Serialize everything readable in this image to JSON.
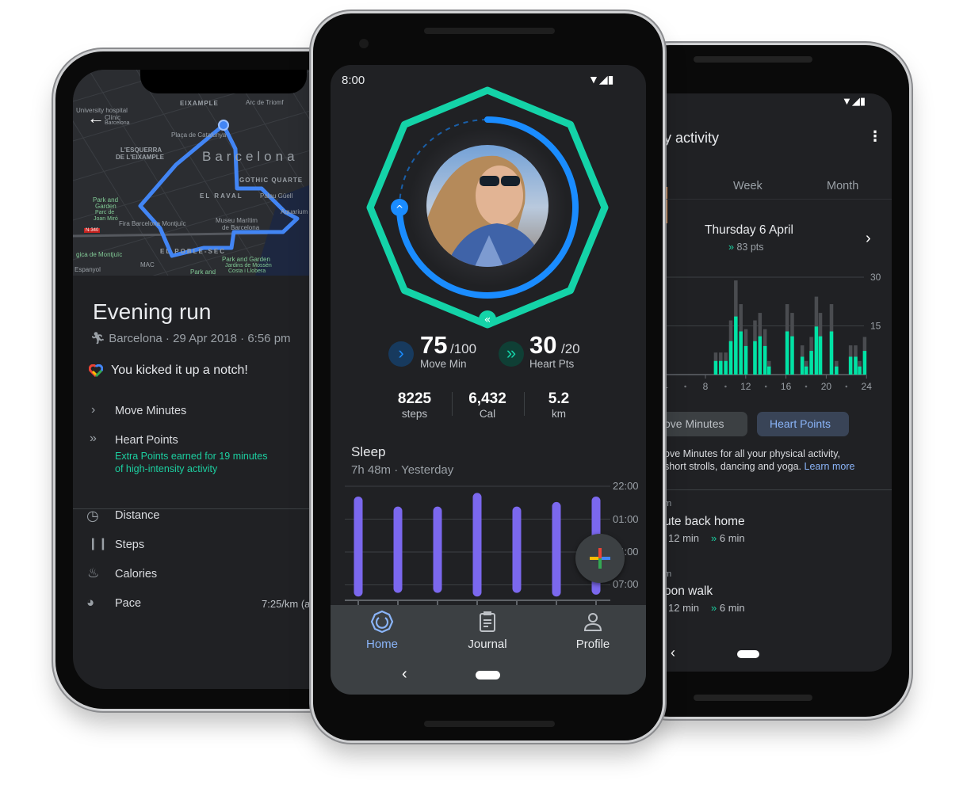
{
  "colors": {
    "teal": "#14d3a8",
    "blue_ring": "#1a8cff",
    "sleep_bar": "#7b68ee",
    "heart_green": "#00e3a5",
    "grey_bar": "#4a4c50",
    "accent_link": "#8ab4f8",
    "background": "#202124"
  },
  "left_phone": {
    "map": {
      "labels": [
        "EIXAMPLE",
        "Arc de Triomf",
        "University hospital",
        "Clínic",
        "Barcelona",
        "Plaça de Catalunya",
        "L'ESQUERRA",
        "DE L'EIXAMPLE",
        "Barcelona",
        "GOTHIC QUARTE",
        "EL RAVAL",
        "Palau Güell",
        "Park and",
        "Garden",
        "Parc de",
        "Joan Miró",
        "Fira Barcelona Montjuïc",
        "Museu Marítim",
        "de Barcelona",
        "Aquarium",
        "N-340",
        "EL POBLE-SEC",
        "Park and Garden",
        "Jardins de Mossèn",
        "Costa i Llobera",
        "MAC",
        "gica de Montjuïc",
        "Espanyol",
        "Park and"
      ],
      "back_icon": "arrow-left-icon"
    },
    "title": "Evening run",
    "subtitle": "Barcelona · 29 Apr 2018 · 6:56 pm",
    "achievement": "You kicked it up a notch!",
    "move_minutes": "Move Minutes",
    "heart_points": "Heart Points",
    "heart_note_1": "Extra Points earned for 19 minutes",
    "heart_note_2": "of high-intensity activity",
    "metrics": [
      {
        "label": "Distance",
        "icon": "distance-icon"
      },
      {
        "label": "Steps",
        "icon": "steps-icon"
      },
      {
        "label": "Calories",
        "icon": "flame-icon"
      },
      {
        "label": "Pace",
        "icon": "speedometer-icon",
        "value": "7:25/km (a"
      }
    ]
  },
  "center_phone": {
    "status_time": "8:00",
    "move_min": {
      "value": "75",
      "goal": "/100",
      "label": "Move Min",
      "progress": 0.75
    },
    "heart_pts": {
      "value": "30",
      "goal": "/20",
      "label": "Heart Pts",
      "progress": 1.0
    },
    "stats": [
      {
        "value": "8225",
        "label": "steps"
      },
      {
        "value": "6,432",
        "label": "Cal"
      },
      {
        "value": "5.2",
        "label": "km"
      }
    ],
    "sleep": {
      "title": "Sleep",
      "subtitle": "7h 48m · Yesterday",
      "axis_labels": [
        "22:00",
        "01:00",
        "04:00",
        "07:00"
      ],
      "bars": [
        {
          "start": "23:20",
          "end": "07:40"
        },
        {
          "start": "00:15",
          "end": "07:20"
        },
        {
          "start": "00:15",
          "end": "07:20"
        },
        {
          "start": "23:00",
          "end": "07:40"
        },
        {
          "start": "00:15",
          "end": "07:20"
        },
        {
          "start": "23:50",
          "end": "07:40"
        },
        {
          "start": "23:20",
          "end": "07:30"
        }
      ]
    },
    "nav": [
      {
        "label": "Home",
        "icon": "home-ring-icon",
        "active": true
      },
      {
        "label": "Journal",
        "icon": "clipboard-icon"
      },
      {
        "label": "Profile",
        "icon": "person-icon"
      }
    ]
  },
  "right_phone": {
    "title": "y activity",
    "tabs": [
      "Week",
      "Month"
    ],
    "date": "Thursday 6 April",
    "points": "83 pts",
    "chart": {
      "y_ticks": [
        "30",
        "15"
      ],
      "x_ticks": [
        "4",
        "8",
        "12",
        "16",
        "20",
        "24"
      ],
      "ylim": [
        0,
        30
      ],
      "bars": [
        {
          "h": 9,
          "total": 6.8,
          "heart": 4.2
        },
        {
          "h": 9.5,
          "total": 6.8,
          "heart": 4.2
        },
        {
          "h": 10,
          "total": 6.8,
          "heart": 4.2
        },
        {
          "h": 10.5,
          "total": 16.7,
          "heart": 10.3
        },
        {
          "h": 11,
          "total": 29,
          "heart": 17.9
        },
        {
          "h": 11.5,
          "total": 21.7,
          "heart": 13.3
        },
        {
          "h": 12,
          "total": 14,
          "heart": 8.8
        },
        {
          "h": 12.9,
          "total": 16.7,
          "heart": 10.3
        },
        {
          "h": 13.4,
          "total": 19,
          "heart": 11.8
        },
        {
          "h": 13.9,
          "total": 14,
          "heart": 8.8
        },
        {
          "h": 14.3,
          "total": 4.2,
          "heart": 2.5
        },
        {
          "h": 16.1,
          "total": 21.7,
          "heart": 13.3
        },
        {
          "h": 16.6,
          "total": 19,
          "heart": 11.8
        },
        {
          "h": 17.6,
          "total": 9,
          "heart": 5.5
        },
        {
          "h": 18,
          "total": 4.2,
          "heart": 2.5
        },
        {
          "h": 18.5,
          "total": 11.6,
          "heart": 7.3
        },
        {
          "h": 19,
          "total": 24,
          "heart": 14.8
        },
        {
          "h": 19.4,
          "total": 19,
          "heart": 11.8
        },
        {
          "h": 20.5,
          "total": 21.7,
          "heart": 13.3
        },
        {
          "h": 21,
          "total": 4.2,
          "heart": 2.5
        },
        {
          "h": 22.4,
          "total": 9,
          "heart": 5.5
        },
        {
          "h": 22.9,
          "total": 9,
          "heart": 5.5
        },
        {
          "h": 23.3,
          "total": 4.2,
          "heart": 2.5
        },
        {
          "h": 23.8,
          "total": 11.6,
          "heart": 7.3
        }
      ]
    },
    "chips": [
      "ove Minutes",
      "Heart Points"
    ],
    "desc_1": "ove Minutes for all your physical activity,",
    "desc_2": "short strolls, dancing and yoga.",
    "learn_more": "Learn more",
    "items": [
      {
        "time": "m",
        "title": "ute back home",
        "move": "12 min",
        "heart": "6 min"
      },
      {
        "time": "m",
        "title": "oon walk",
        "move": "12 min",
        "heart": "6 min"
      }
    ]
  }
}
